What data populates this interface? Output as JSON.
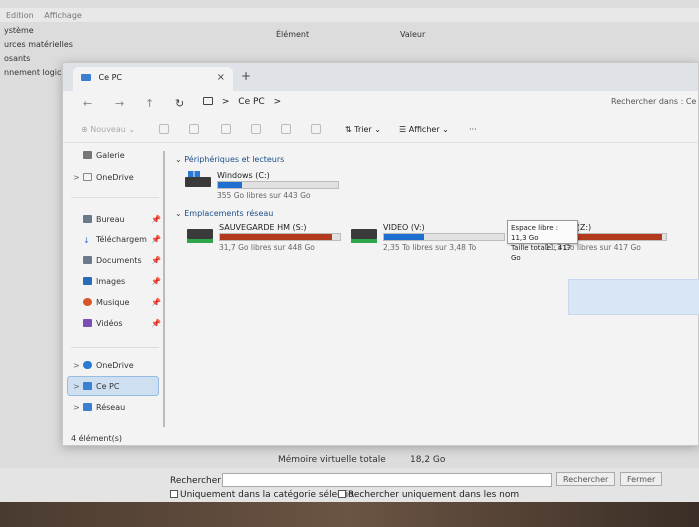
{
  "background_window": {
    "menu": [
      "Edition",
      "Affichage"
    ],
    "tree": [
      "ystème",
      "urces matérielles",
      "osants",
      "nnement logici"
    ],
    "columns": [
      "Élément",
      "Valeur"
    ],
    "bottom_row": {
      "item": "Mémoire virtuelle totale",
      "value": "18,2 Go"
    },
    "search_label": "Rechercher",
    "search_button": "Rechercher",
    "close_button": "Fermer",
    "check_category": "Uniquement dans la catégorie sélectio",
    "check_names": "Rechercher uniquement dans les nom"
  },
  "explorer": {
    "tab_title": "Ce PC",
    "tab_close": "×",
    "new_tab": "+",
    "nav": {
      "back": "←",
      "forward": "→",
      "up": "↑",
      "refresh": "↻"
    },
    "address": {
      "sep": ">",
      "location": "Ce PC",
      "chevron": ">"
    },
    "search_placeholder": "Rechercher dans : Ce P",
    "commands": {
      "new": "Nouveau",
      "sort": "Trier",
      "view": "Afficher",
      "more": "···"
    },
    "sidebar": {
      "gallery": "Galerie",
      "onedrive_top": "OneDrive",
      "desktop": "Bureau",
      "downloads": "Téléchargem",
      "documents": "Documents",
      "images": "Images",
      "music": "Musique",
      "videos": "Vidéos",
      "onedrive": "OneDrive",
      "this_pc": "Ce PC",
      "network": "Réseau"
    },
    "status": "4 élément(s)",
    "groups": {
      "devices": "Périphériques et lecteurs",
      "network": "Emplacements réseau"
    },
    "drives": [
      {
        "name": "Windows (C:)",
        "info": "355 Go libres sur 443 Go",
        "used_fraction": 0.2
      },
      {
        "name": "SAUVEGARDE HM (S:)",
        "info": "31,7 Go libres sur 448 Go",
        "used_fraction": 0.93
      },
      {
        "name": "VIDEO (V:)",
        "info": "2,35 To libres sur 3,48 To",
        "used_fraction": 0.33
      },
      {
        "name": "FORUM (Z:)",
        "info": "11,3 Go libres sur 417 Go",
        "used_fraction": 0.97
      }
    ],
    "tooltip": {
      "free": "Espace libre : 11,3 Go",
      "total": "Taille totale : 417 Go"
    },
    "colors": {
      "used_ok": "#1f6fd1",
      "used_full": "#b13a1f",
      "accent": "#1b4f8a"
    }
  }
}
